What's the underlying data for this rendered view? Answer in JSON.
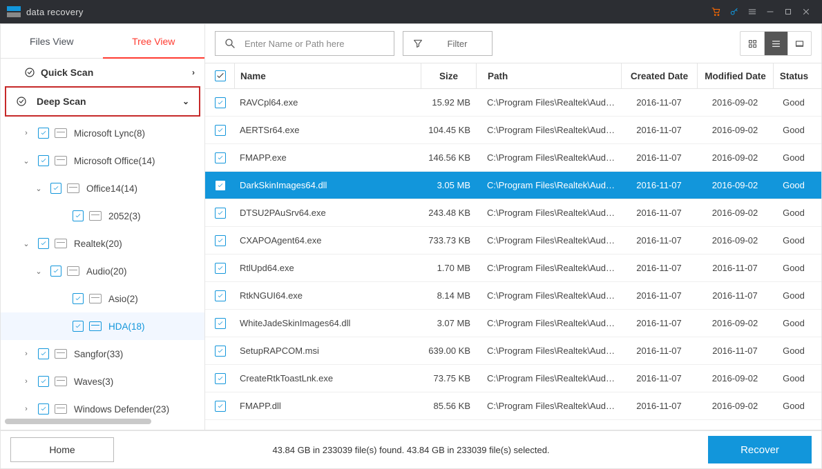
{
  "app": {
    "title": "data recovery"
  },
  "sidebar": {
    "tabs": [
      "Files View",
      "Tree View"
    ],
    "quick_scan": "Quick Scan",
    "deep_scan": "Deep Scan",
    "tree": [
      {
        "lvl": 1,
        "arrow": "›",
        "label": "Microsoft Lync(8)",
        "sel": false
      },
      {
        "lvl": 1,
        "arrow": "⌄",
        "label": "Microsoft Office(14)",
        "sel": false
      },
      {
        "lvl": 2,
        "arrow": "⌄",
        "label": "Office14(14)",
        "sel": false
      },
      {
        "lvl": 3,
        "arrow": "",
        "label": "2052(3)",
        "sel": false
      },
      {
        "lvl": 1,
        "arrow": "⌄",
        "label": "Realtek(20)",
        "sel": false
      },
      {
        "lvl": 2,
        "arrow": "⌄",
        "label": "Audio(20)",
        "sel": false
      },
      {
        "lvl": 3,
        "arrow": "",
        "label": "Asio(2)",
        "sel": false
      },
      {
        "lvl": 3,
        "arrow": "",
        "label": "HDA(18)",
        "sel": true
      },
      {
        "lvl": 1,
        "arrow": "›",
        "label": "Sangfor(33)",
        "sel": false
      },
      {
        "lvl": 1,
        "arrow": "›",
        "label": "Waves(3)",
        "sel": false
      },
      {
        "lvl": 1,
        "arrow": "›",
        "label": "Windows Defender(23)",
        "sel": false
      }
    ]
  },
  "toolbar": {
    "search_placeholder": "Enter Name or Path here",
    "filter_label": "Filter"
  },
  "table": {
    "headers": {
      "name": "Name",
      "size": "Size",
      "path": "Path",
      "cdate": "Created Date",
      "mdate": "Modified Date",
      "status": "Status"
    },
    "rows": [
      {
        "name": "RAVCpl64.exe",
        "size": "15.92 MB",
        "path": "C:\\Program Files\\Realtek\\Audio\\...",
        "cdate": "2016-11-07",
        "mdate": "2016-09-02",
        "status": "Good",
        "sel": false
      },
      {
        "name": "AERTSr64.exe",
        "size": "104.45 KB",
        "path": "C:\\Program Files\\Realtek\\Audio\\...",
        "cdate": "2016-11-07",
        "mdate": "2016-09-02",
        "status": "Good",
        "sel": false
      },
      {
        "name": "FMAPP.exe",
        "size": "146.56 KB",
        "path": "C:\\Program Files\\Realtek\\Audio\\...",
        "cdate": "2016-11-07",
        "mdate": "2016-09-02",
        "status": "Good",
        "sel": false
      },
      {
        "name": "DarkSkinImages64.dll",
        "size": "3.05 MB",
        "path": "C:\\Program Files\\Realtek\\Audio\\...",
        "cdate": "2016-11-07",
        "mdate": "2016-09-02",
        "status": "Good",
        "sel": true
      },
      {
        "name": "DTSU2PAuSrv64.exe",
        "size": "243.48 KB",
        "path": "C:\\Program Files\\Realtek\\Audio\\...",
        "cdate": "2016-11-07",
        "mdate": "2016-09-02",
        "status": "Good",
        "sel": false
      },
      {
        "name": "CXAPOAgent64.exe",
        "size": "733.73 KB",
        "path": "C:\\Program Files\\Realtek\\Audio\\...",
        "cdate": "2016-11-07",
        "mdate": "2016-09-02",
        "status": "Good",
        "sel": false
      },
      {
        "name": "RtlUpd64.exe",
        "size": "1.70 MB",
        "path": "C:\\Program Files\\Realtek\\Audio\\...",
        "cdate": "2016-11-07",
        "mdate": "2016-11-07",
        "status": "Good",
        "sel": false
      },
      {
        "name": "RtkNGUI64.exe",
        "size": "8.14 MB",
        "path": "C:\\Program Files\\Realtek\\Audio\\...",
        "cdate": "2016-11-07",
        "mdate": "2016-11-07",
        "status": "Good",
        "sel": false
      },
      {
        "name": "WhiteJadeSkinImages64.dll",
        "size": "3.07 MB",
        "path": "C:\\Program Files\\Realtek\\Audio\\...",
        "cdate": "2016-11-07",
        "mdate": "2016-09-02",
        "status": "Good",
        "sel": false
      },
      {
        "name": "SetupRAPCOM.msi",
        "size": "639.00 KB",
        "path": "C:\\Program Files\\Realtek\\Audio\\...",
        "cdate": "2016-11-07",
        "mdate": "2016-11-07",
        "status": "Good",
        "sel": false
      },
      {
        "name": "CreateRtkToastLnk.exe",
        "size": "73.75 KB",
        "path": "C:\\Program Files\\Realtek\\Audio\\...",
        "cdate": "2016-11-07",
        "mdate": "2016-09-02",
        "status": "Good",
        "sel": false
      },
      {
        "name": "FMAPP.dll",
        "size": "85.56 KB",
        "path": "C:\\Program Files\\Realtek\\Audio\\...",
        "cdate": "2016-11-07",
        "mdate": "2016-09-02",
        "status": "Good",
        "sel": false
      }
    ]
  },
  "footer": {
    "home": "Home",
    "status": "43.84 GB in 233039 file(s) found.   43.84 GB in 233039 file(s) selected.",
    "recover": "Recover"
  }
}
